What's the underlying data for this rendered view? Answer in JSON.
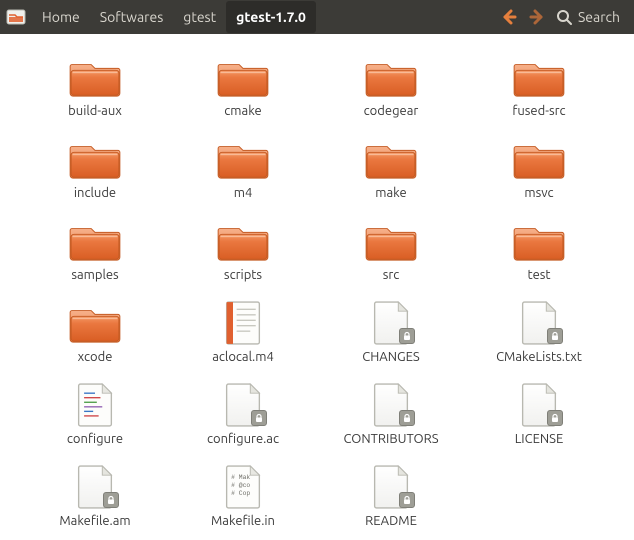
{
  "toolbar": {
    "breadcrumbs": [
      "Home",
      "Softwares",
      "gtest",
      "gtest-1.7.0"
    ],
    "current_index": 3,
    "search_label": "Search"
  },
  "items": [
    {
      "name": "build-aux",
      "type": "folder"
    },
    {
      "name": "cmake",
      "type": "folder"
    },
    {
      "name": "codegear",
      "type": "folder"
    },
    {
      "name": "fused-src",
      "type": "folder"
    },
    {
      "name": "include",
      "type": "folder"
    },
    {
      "name": "m4",
      "type": "folder"
    },
    {
      "name": "make",
      "type": "folder"
    },
    {
      "name": "msvc",
      "type": "folder"
    },
    {
      "name": "samples",
      "type": "folder"
    },
    {
      "name": "scripts",
      "type": "folder"
    },
    {
      "name": "src",
      "type": "folder"
    },
    {
      "name": "test",
      "type": "folder"
    },
    {
      "name": "xcode",
      "type": "folder"
    },
    {
      "name": "aclocal.m4",
      "type": "text"
    },
    {
      "name": "CHANGES",
      "type": "locked"
    },
    {
      "name": "CMakeLists.txt",
      "type": "locked"
    },
    {
      "name": "configure",
      "type": "script"
    },
    {
      "name": "configure.ac",
      "type": "locked"
    },
    {
      "name": "CONTRIBUTORS",
      "type": "locked"
    },
    {
      "name": "LICENSE",
      "type": "locked"
    },
    {
      "name": "Makefile.am",
      "type": "locked"
    },
    {
      "name": "Makefile.in",
      "type": "makefile"
    },
    {
      "name": "README",
      "type": "locked"
    }
  ]
}
